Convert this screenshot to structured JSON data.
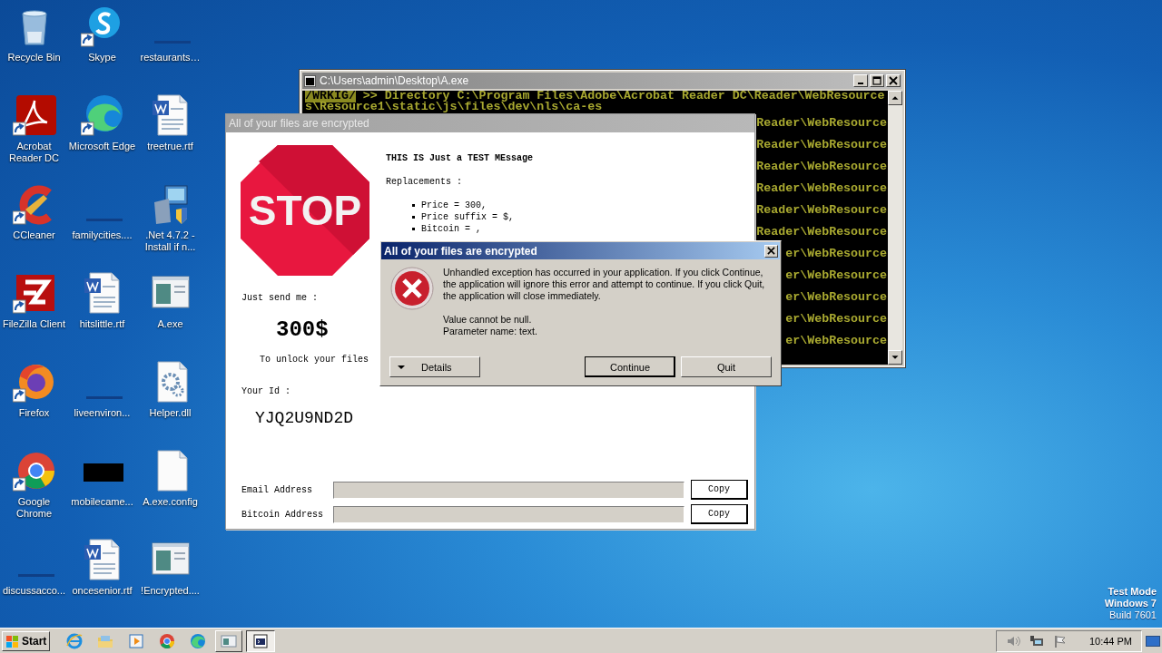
{
  "desktop": {
    "icons": [
      {
        "label": "Recycle Bin",
        "kind": "recycle",
        "shortcut": false
      },
      {
        "label": "Skype",
        "kind": "skype",
        "shortcut": true
      },
      {
        "label": "restaurants…",
        "kind": "blank",
        "shortcut": false
      },
      {
        "label": "Acrobat Reader DC",
        "kind": "acrobat",
        "shortcut": true
      },
      {
        "label": "Microsoft Edge",
        "kind": "edge",
        "shortcut": true
      },
      {
        "label": "treetrue.rtf",
        "kind": "word",
        "shortcut": false
      },
      {
        "label": "CCleaner",
        "kind": "ccleaner",
        "shortcut": true
      },
      {
        "label": "familycities....",
        "kind": "blank",
        "shortcut": false
      },
      {
        "label": ".Net 4.7.2 - Install if n...",
        "kind": "installer",
        "shortcut": false
      },
      {
        "label": "FileZilla Client",
        "kind": "filezilla",
        "shortcut": true
      },
      {
        "label": "hitslittle.rtf",
        "kind": "word",
        "shortcut": false
      },
      {
        "label": "A.exe",
        "kind": "app",
        "shortcut": false
      },
      {
        "label": "Firefox",
        "kind": "firefox",
        "shortcut": true
      },
      {
        "label": "liveenviron...",
        "kind": "blank",
        "shortcut": false
      },
      {
        "label": "Helper.dll",
        "kind": "dll",
        "shortcut": false
      },
      {
        "label": "Google Chrome",
        "kind": "chrome",
        "shortcut": true
      },
      {
        "label": "mobilecame...",
        "kind": "black",
        "shortcut": false
      },
      {
        "label": "A.exe.config",
        "kind": "file",
        "shortcut": false
      },
      {
        "label": "discussacco...",
        "kind": "blank",
        "shortcut": false
      },
      {
        "label": "oncesenior.rtf",
        "kind": "word",
        "shortcut": false
      },
      {
        "label": "!Encrypted....",
        "kind": "app",
        "shortcut": false
      }
    ],
    "system_text": [
      "Test Mode",
      "Windows 7",
      "Build 7601"
    ]
  },
  "console_window": {
    "title": "C:\\Users\\admin\\Desktop\\A.exe",
    "tag": "/WRKIG/",
    "first_line": " >> Directory C:\\Program Files\\Adobe\\Acrobat Reader DC\\Reader\\WebResource",
    "second_line": "s\\Resource1\\static\\js\\files\\dev\\nls\\ca-es",
    "visible_fragments": [
      "Reader\\WebResource",
      "Reader\\WebResource",
      "Reader\\WebResource",
      "Reader\\WebResource",
      "Reader\\WebResource",
      "Reader\\WebResource",
      "er\\WebResource",
      "er\\WebResource",
      "er\\WebResource",
      "er\\WebResource",
      "er\\WebResource"
    ]
  },
  "ransom_window": {
    "title": "All of your files are encrypted",
    "stop_text": "STOP",
    "headline": "THIS IS Just a TEST MEssage",
    "replacements_label": "Replacements :",
    "replacements": [
      "Price = 300,",
      "Price suffix = $,",
      "Bitcoin = ,"
    ],
    "send_label": "Just send me :",
    "amount": "300$",
    "unlock_text": "To unlock your files",
    "id_label": "Your Id :",
    "id": "YJQ2U9ND2D",
    "fields": [
      {
        "label": "Email Address",
        "button": "Copy"
      },
      {
        "label": "Bitcoin Address",
        "button": "Copy"
      }
    ]
  },
  "error_dialog": {
    "title": "All of your files are encrypted",
    "message": "Unhandled exception has occurred in your application. If you click Continue, the application will ignore this error and attempt to continue. If you click Quit, the application will close immediately.",
    "detail_lines": [
      "Value cannot be null.",
      "Parameter name: text."
    ],
    "buttons": [
      {
        "label": "Details",
        "kind": "expander",
        "default": false
      },
      {
        "label": "Continue",
        "kind": "plain",
        "default": true
      },
      {
        "label": "Quit",
        "kind": "plain",
        "default": false
      }
    ]
  },
  "taskbar": {
    "start": "Start",
    "pinned": [
      {
        "kind": "ie",
        "selected": false
      },
      {
        "kind": "folder",
        "selected": false
      },
      {
        "kind": "media",
        "selected": false
      },
      {
        "kind": "chrome",
        "selected": false
      },
      {
        "kind": "edge",
        "selected": false
      },
      {
        "kind": "app",
        "selected": false
      },
      {
        "kind": "console",
        "selected": true
      }
    ],
    "clock": "10:44 PM"
  }
}
